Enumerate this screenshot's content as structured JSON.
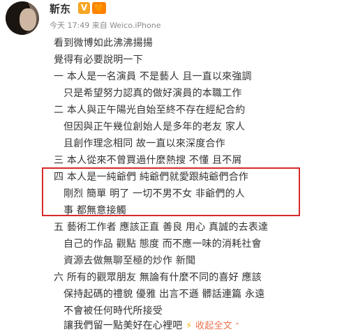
{
  "author": {
    "name": "靳东",
    "verified_badge": "V",
    "vip_badge": "会员"
  },
  "post": {
    "meta": "今天 17:49 来自 Weico.iPhone",
    "lines": [
      "看到微博如此沸沸揚揚",
      "覺得有必要說明一下",
      "一 本人是一名演員 不是藝人 且一直以來強調",
      "只是希望努力認真的做好演員的本職工作",
      "二 本人與正午陽光自始至終不存在經紀合約",
      "但因與正午幾位創始人是多年的老友 家人",
      "且創作理念相同 故一直以來深度合作",
      "三 本人從來不曾買過什麼熱搜 不懂 且不屑",
      "四 本人是一純爺們 純爺們就愛跟純爺們合作",
      "剛烈 簡單 明了 一切不男不女 非爺們的人",
      "事 都無意接觸",
      "五 藝術工作者 應該正直 善良 用心 真誠的去表達",
      "自己的作品 觀點 態度 而不應一味的消耗社會",
      "資源去做無聊至極的炒作 新聞",
      "六 所有的觀眾朋友 無論有什麼不同的喜好 應該",
      "保持起碼的禮貌 優雅 出言不遜 髒話連篇 永遠",
      "不會被任何時代所接受",
      "讓我們留一點美好在心裡吧"
    ],
    "expand_label": "收起全文",
    "expand_icon": "chevron-up",
    "highlight_color": "#d62a2a",
    "link_color": "#eb7350"
  }
}
